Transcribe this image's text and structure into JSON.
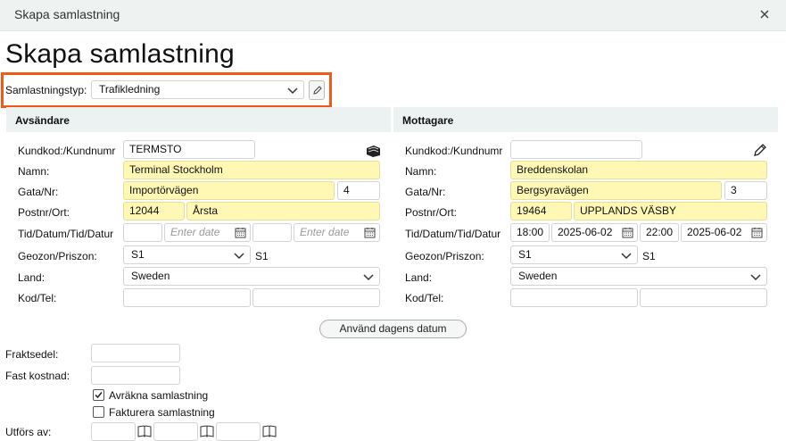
{
  "window": {
    "title": "Skapa samlastning",
    "heading": "Skapa samlastning"
  },
  "colors": {
    "accent": "#ee5a1a",
    "highlight_field": "#fef8b4",
    "section_bg": "#ebf2f1"
  },
  "samlastningstyp": {
    "label": "Samlastningstyp:",
    "value": "Trafikledning"
  },
  "sender": {
    "header": "Avsändare",
    "labels": {
      "kundkod": "Kundkod:/Kundnumr",
      "namn": "Namn:",
      "gata": "Gata/Nr:",
      "postnr": "Postnr/Ort:",
      "tid": "Tid/Datum/Tid/Datur",
      "geozon": "Geozon/Priszon:",
      "land": "Land:",
      "kodtel": "Kod/Tel:"
    },
    "kundkod": "TERMSTO",
    "namn": "Terminal Stockholm",
    "gata": "Importörvägen",
    "nr": "4",
    "postnr": "12044",
    "ort": "Årsta",
    "tid1": "",
    "datum1_placeholder": "Enter date",
    "tid2": "",
    "datum2_placeholder": "Enter date",
    "geozon": "S1",
    "priszon": "S1",
    "land": "Sweden"
  },
  "receiver": {
    "header": "Mottagare",
    "labels": {
      "kundkod": "Kundkod:/Kundnumr",
      "namn": "Namn:",
      "gata": "Gata/Nr:",
      "postnr": "Postnr/Ort:",
      "tid": "Tid/Datum/Tid/Datur",
      "geozon": "Geozon/Priszon:",
      "land": "Land:",
      "kodtel": "Kod/Tel:"
    },
    "kundkod": "",
    "namn": "Breddenskolan",
    "gata": "Bergsyravägen",
    "nr": "3",
    "postnr": "19464",
    "ort": "UPPLANDS VÄSBY",
    "tid1": "18:00",
    "datum1": "2025-06-02",
    "tid2": "22:00",
    "datum2": "2025-06-02",
    "geozon": "S1",
    "priszon": "S1",
    "land": "Sweden"
  },
  "use_today_button": "Använd dagens datum",
  "bottom": {
    "fraktsedel_label": "Fraktsedel:",
    "fast_kostnad_label": "Fast kostnad:",
    "avrakna_label": "Avräkna samlastning",
    "avrakna_checked": true,
    "fakturera_label": "Fakturera samlastning",
    "fakturera_checked": false,
    "utfors_label": "Utförs av:"
  }
}
